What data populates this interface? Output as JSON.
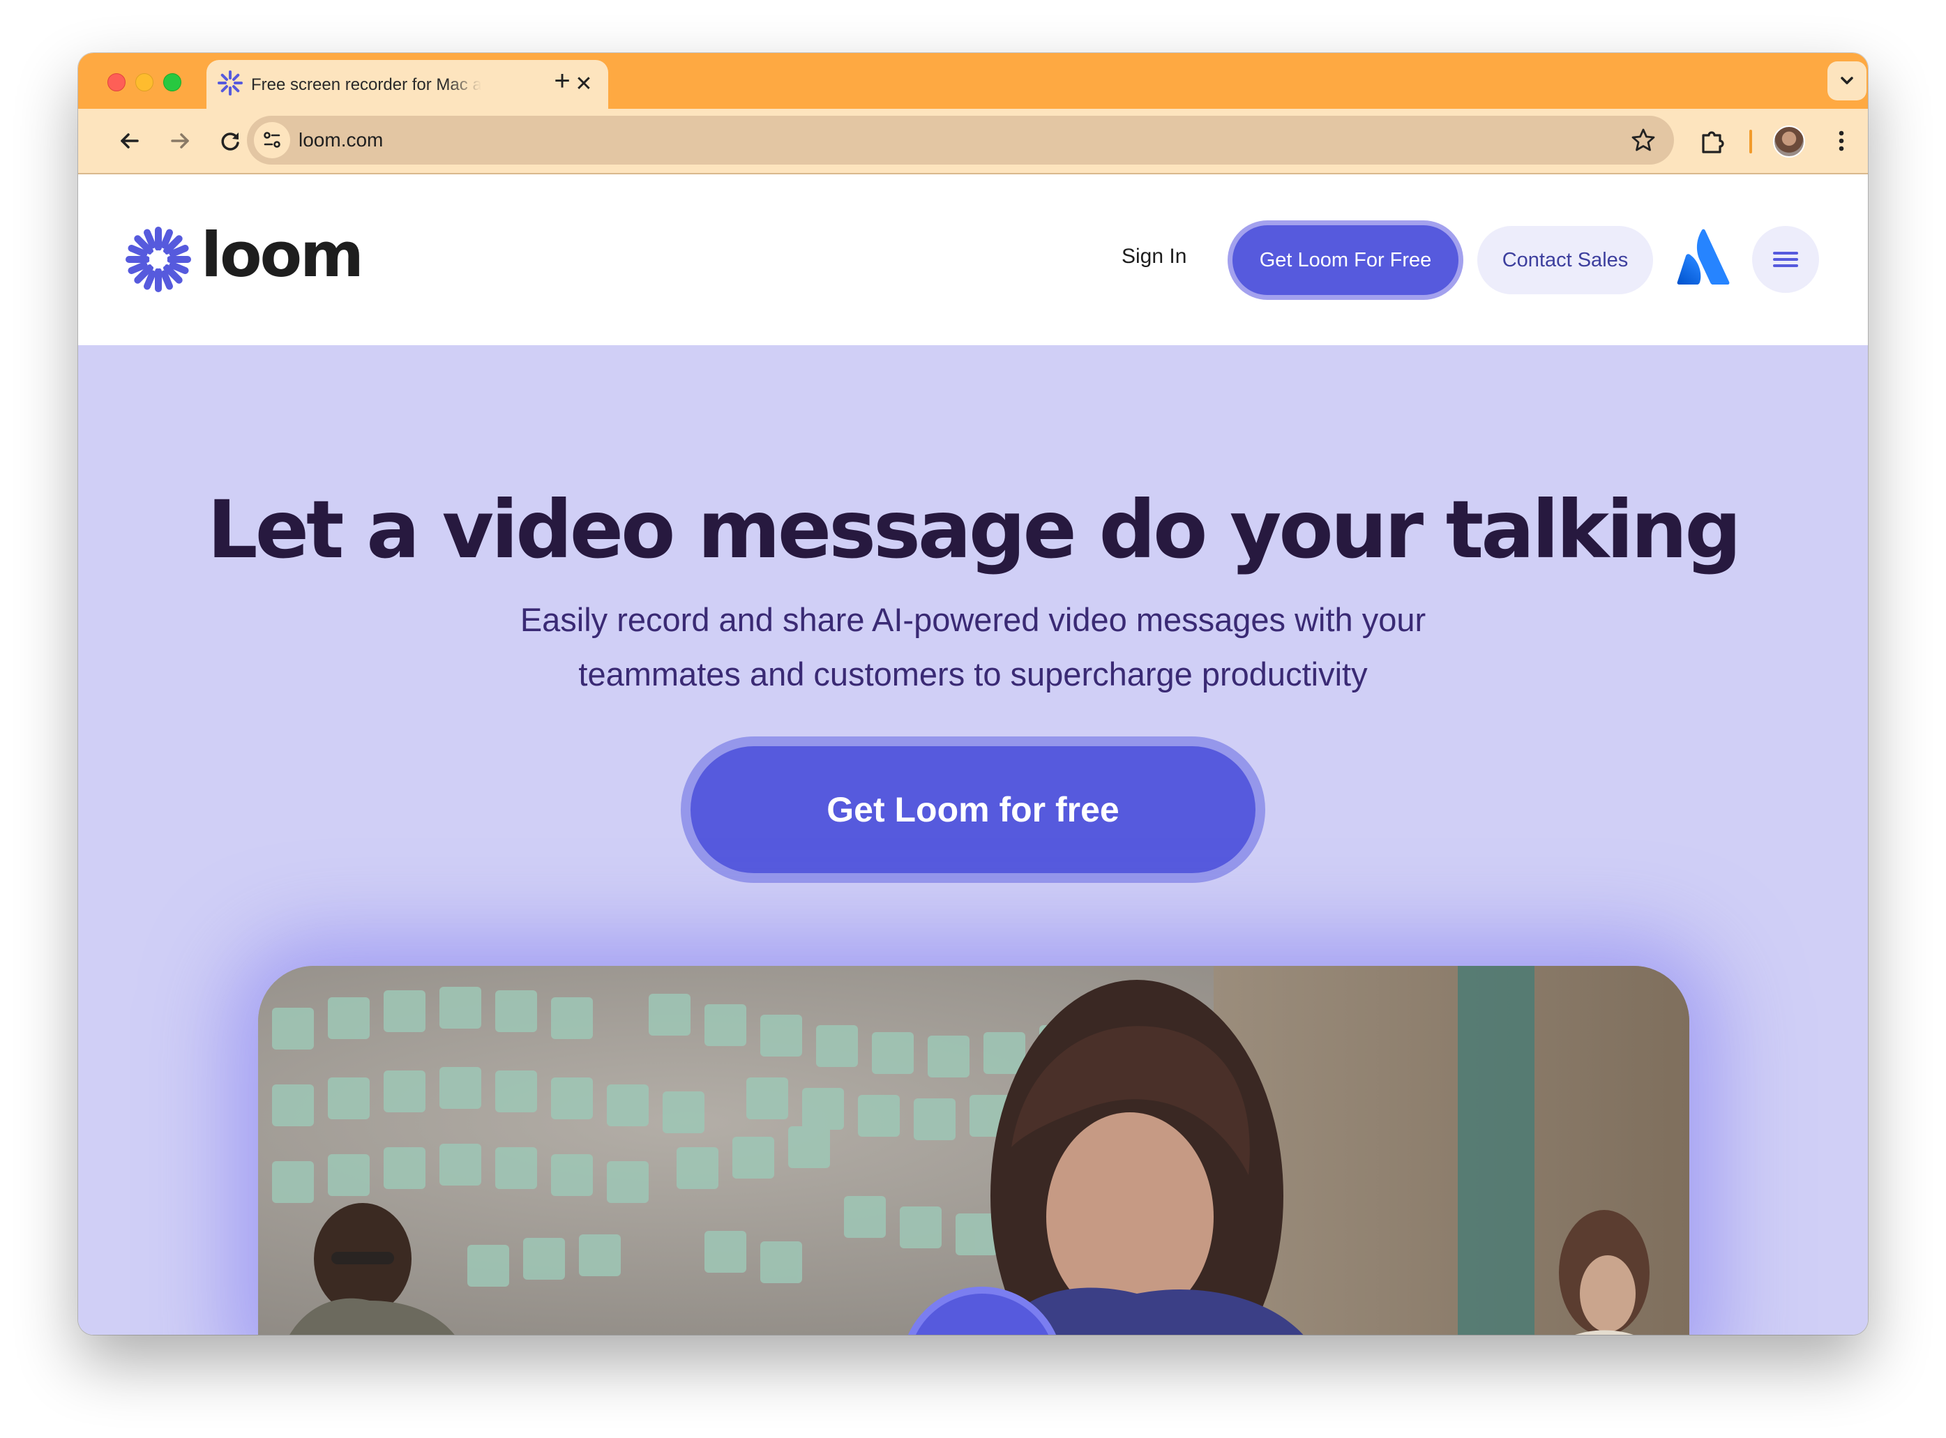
{
  "browser": {
    "tab_title": "Free screen recorder for Mac and PC | Loom",
    "tab_close": "✕",
    "new_tab": "+",
    "url": "loom.com"
  },
  "site": {
    "logo_text": "loom",
    "nav": {
      "sign_in": "Sign In",
      "get_loom": "Get Loom For Free",
      "contact_sales": "Contact Sales"
    }
  },
  "hero": {
    "title": "Let a video message do your talking",
    "subtitle": "Easily record and share AI-powered video messages with your teammates and customers to supercharge productivity",
    "cta": "Get Loom for free"
  },
  "colors": {
    "brand": "#565add",
    "hero_bg": "#d0cff6",
    "browser_frame": "#fea942"
  }
}
